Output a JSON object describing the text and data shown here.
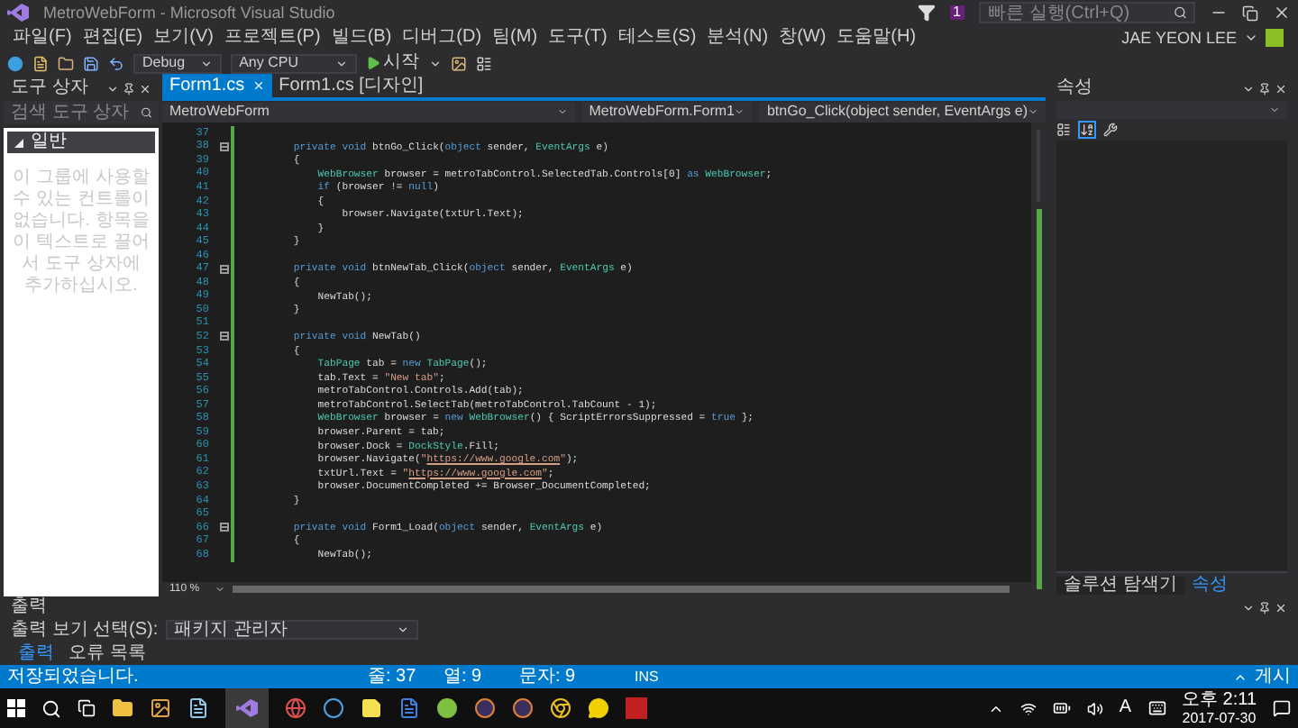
{
  "window": {
    "title": "MetroWebForm - Microsoft Visual Studio",
    "notification_count": "1",
    "quick_launch": {
      "placeholder": "빠른 실행(Ctrl+Q)"
    }
  },
  "menu": [
    "파일(F)",
    "편집(E)",
    "보기(V)",
    "프로젝트(P)",
    "빌드(B)",
    "디버그(D)",
    "팀(M)",
    "도구(T)",
    "테스트(S)",
    "분석(N)",
    "창(W)",
    "도움말(H)"
  ],
  "account": {
    "name": "JAE YEON LEE"
  },
  "toolbar": {
    "configuration": "Debug",
    "platform": "Any CPU",
    "start": "시작"
  },
  "toolbox": {
    "title": "도구 상자",
    "search": {
      "placeholder": "검색 도구 상자"
    },
    "group": {
      "label": "일반",
      "expanded": true
    },
    "message": "이 그룹에 사용할 수 있는 컨트롤이 없습니다. 항목을 이 텍스트로 끌어서 도구 상자에 추가하십시오."
  },
  "editor": {
    "tabs": [
      {
        "label": "Form1.cs",
        "selected": true
      },
      {
        "label": "Form1.cs [디자인]",
        "selected": false
      }
    ],
    "nav": [
      "MetroWebForm",
      "MetroWebForm.Form1",
      "btnGo_Click(object sender, EventArgs e)"
    ],
    "lines": [
      {
        "number": "37",
        "fold": false
      },
      {
        "number": "38",
        "fold": true,
        "tokens": [
          {
            "text": "        private void",
            "kind": "keyword"
          },
          {
            "text": " btnGo_Click(",
            "kind": "plain"
          },
          {
            "text": "object",
            "kind": "keyword"
          },
          {
            "text": " sender, ",
            "kind": "plain"
          },
          {
            "text": "EventArgs",
            "kind": "type"
          },
          {
            "text": " e)",
            "kind": "plain"
          }
        ]
      },
      {
        "number": "39",
        "fold": false,
        "tokens": [
          {
            "text": "        {",
            "kind": "plain"
          }
        ]
      },
      {
        "number": "40",
        "fold": false,
        "tokens": [
          {
            "text": "            WebBrowser",
            "kind": "type"
          },
          {
            "text": " browser = metroTabControl.SelectedTab.Controls[0] ",
            "kind": "plain"
          },
          {
            "text": "as",
            "kind": "keyword"
          },
          {
            "text": " WebBrowser",
            "kind": "type"
          },
          {
            "text": ";",
            "kind": "plain"
          }
        ]
      },
      {
        "number": "41",
        "fold": false,
        "tokens": [
          {
            "text": "            if",
            "kind": "keyword"
          },
          {
            "text": " (browser != ",
            "kind": "plain"
          },
          {
            "text": "null",
            "kind": "keyword"
          },
          {
            "text": ")",
            "kind": "plain"
          }
        ]
      },
      {
        "number": "42",
        "fold": false,
        "tokens": [
          {
            "text": "            {",
            "kind": "plain"
          }
        ]
      },
      {
        "number": "43",
        "fold": false,
        "tokens": [
          {
            "text": "                browser.Navigate(txtUrl.Text);",
            "kind": "plain"
          }
        ]
      },
      {
        "number": "44",
        "fold": false,
        "tokens": [
          {
            "text": "            }",
            "kind": "plain"
          }
        ]
      },
      {
        "number": "45",
        "fold": false,
        "tokens": [
          {
            "text": "        }",
            "kind": "plain"
          }
        ]
      },
      {
        "number": "46",
        "fold": false
      },
      {
        "number": "47",
        "fold": true,
        "tokens": [
          {
            "text": "        private void",
            "kind": "keyword"
          },
          {
            "text": " btnNewTab_Click(",
            "kind": "plain"
          },
          {
            "text": "object",
            "kind": "keyword"
          },
          {
            "text": " sender, ",
            "kind": "plain"
          },
          {
            "text": "EventArgs",
            "kind": "type"
          },
          {
            "text": " e)",
            "kind": "plain"
          }
        ]
      },
      {
        "number": "48",
        "fold": false,
        "tokens": [
          {
            "text": "        {",
            "kind": "plain"
          }
        ]
      },
      {
        "number": "49",
        "fold": false,
        "tokens": [
          {
            "text": "            NewTab();",
            "kind": "plain"
          }
        ]
      },
      {
        "number": "50",
        "fold": false,
        "tokens": [
          {
            "text": "        }",
            "kind": "plain"
          }
        ]
      },
      {
        "number": "51",
        "fold": false
      },
      {
        "number": "52",
        "fold": true,
        "tokens": [
          {
            "text": "        private void",
            "kind": "keyword"
          },
          {
            "text": " NewTab()",
            "kind": "plain"
          }
        ]
      },
      {
        "number": "53",
        "fold": false,
        "tokens": [
          {
            "text": "        {",
            "kind": "plain"
          }
        ]
      },
      {
        "number": "54",
        "fold": false,
        "tokens": [
          {
            "text": "            TabPage",
            "kind": "type"
          },
          {
            "text": " tab = ",
            "kind": "plain"
          },
          {
            "text": "new",
            "kind": "keyword"
          },
          {
            "text": " TabPage",
            "kind": "type"
          },
          {
            "text": "();",
            "kind": "plain"
          }
        ]
      },
      {
        "number": "55",
        "fold": false,
        "tokens": [
          {
            "text": "            tab.Text = ",
            "kind": "plain"
          },
          {
            "text": "\"New tab\"",
            "kind": "string"
          },
          {
            "text": ";",
            "kind": "plain"
          }
        ]
      },
      {
        "number": "56",
        "fold": false,
        "tokens": [
          {
            "text": "            metroTabControl.Controls.Add(tab);",
            "kind": "plain"
          }
        ]
      },
      {
        "number": "57",
        "fold": false,
        "tokens": [
          {
            "text": "            metroTabControl.SelectTab(metroTabControl.TabCount - 1);",
            "kind": "plain"
          }
        ]
      },
      {
        "number": "58",
        "fold": false,
        "tokens": [
          {
            "text": "            WebBrowser",
            "kind": "type"
          },
          {
            "text": " browser = ",
            "kind": "plain"
          },
          {
            "text": "new",
            "kind": "keyword"
          },
          {
            "text": " WebBrowser",
            "kind": "type"
          },
          {
            "text": "() { ScriptErrorsSuppressed = ",
            "kind": "plain"
          },
          {
            "text": "true",
            "kind": "keyword"
          },
          {
            "text": " };",
            "kind": "plain"
          }
        ]
      },
      {
        "number": "59",
        "fold": false,
        "tokens": [
          {
            "text": "            browser.Parent = tab;",
            "kind": "plain"
          }
        ]
      },
      {
        "number": "60",
        "fold": false,
        "tokens": [
          {
            "text": "            browser.Dock = ",
            "kind": "plain"
          },
          {
            "text": "DockStyle",
            "kind": "type"
          },
          {
            "text": ".Fill;",
            "kind": "plain"
          }
        ]
      },
      {
        "number": "61",
        "fold": false,
        "tokens": [
          {
            "text": "            browser.Navigate(",
            "kind": "plain"
          },
          {
            "text": "\"",
            "kind": "string"
          },
          {
            "text": "https://www.google.com",
            "kind": "link"
          },
          {
            "text": "\"",
            "kind": "string"
          },
          {
            "text": ");",
            "kind": "plain"
          }
        ]
      },
      {
        "number": "62",
        "fold": false,
        "tokens": [
          {
            "text": "            txtUrl.Text = ",
            "kind": "plain"
          },
          {
            "text": "\"",
            "kind": "string"
          },
          {
            "text": "https://www.google.com",
            "kind": "link"
          },
          {
            "text": "\"",
            "kind": "string"
          },
          {
            "text": ";",
            "kind": "plain"
          }
        ]
      },
      {
        "number": "63",
        "fold": false,
        "tokens": [
          {
            "text": "            browser.DocumentCompleted += Browser_DocumentCompleted;",
            "kind": "plain"
          }
        ]
      },
      {
        "number": "64",
        "fold": false,
        "tokens": [
          {
            "text": "        }",
            "kind": "plain"
          }
        ]
      },
      {
        "number": "65",
        "fold": false
      },
      {
        "number": "66",
        "fold": true,
        "tokens": [
          {
            "text": "        private void",
            "kind": "keyword"
          },
          {
            "text": " Form1_Load(",
            "kind": "plain"
          },
          {
            "text": "object",
            "kind": "keyword"
          },
          {
            "text": " sender, ",
            "kind": "plain"
          },
          {
            "text": "EventArgs",
            "kind": "type"
          },
          {
            "text": " e)",
            "kind": "plain"
          }
        ]
      },
      {
        "number": "67",
        "fold": false,
        "tokens": [
          {
            "text": "        {",
            "kind": "plain"
          }
        ]
      },
      {
        "number": "68",
        "fold": false,
        "tokens": [
          {
            "text": "            NewTab();",
            "kind": "plain"
          }
        ]
      }
    ],
    "zoom": "110 %"
  },
  "properties": {
    "title": "속성",
    "bottom_tabs": [
      {
        "label": "솔루션 탐색기",
        "selected": false
      },
      {
        "label": "속성",
        "selected": true
      }
    ]
  },
  "output": {
    "title": "출력",
    "source_label": "출력 보기 선택(S):",
    "source": "패키지 관리자",
    "tabs": [
      {
        "label": "출력",
        "selected": true
      },
      {
        "label": "오류 목록",
        "selected": false
      }
    ]
  },
  "status_bar": {
    "message": "저장되었습니다.",
    "line": "줄: 37",
    "column": "열: 9",
    "char": "문자: 9",
    "mode": "INS",
    "publish": "게시"
  },
  "taskbar": {
    "ime": "A",
    "time": "오후 2:11",
    "date": "2017-07-30"
  }
}
